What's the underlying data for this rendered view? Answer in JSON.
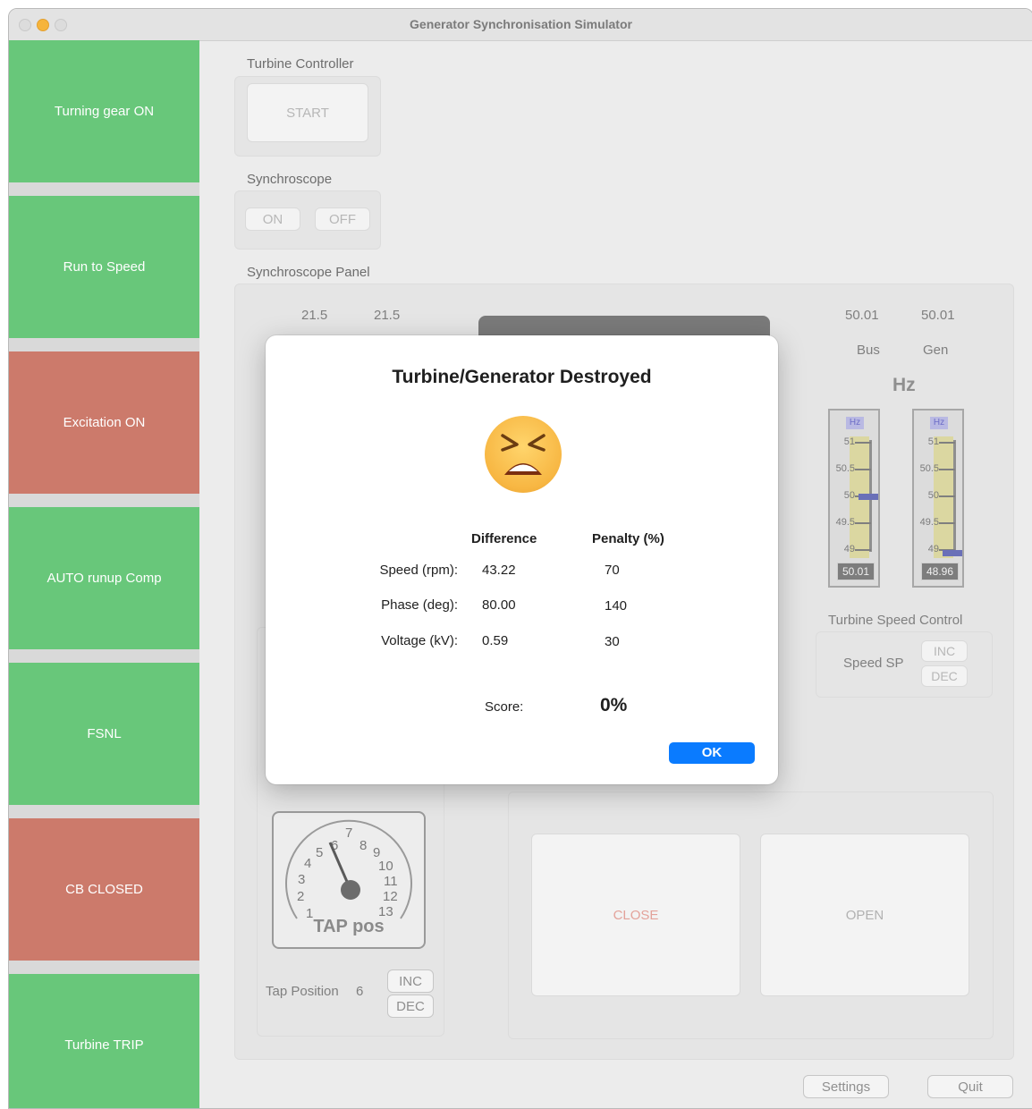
{
  "window": {
    "title": "Generator Synchronisation Simulator"
  },
  "sidebar": {
    "items": [
      {
        "label": "Turning gear ON",
        "status": "green"
      },
      {
        "label": "Run to Speed",
        "status": "green"
      },
      {
        "label": "Excitation ON",
        "status": "red"
      },
      {
        "label": "AUTO runup Comp",
        "status": "green"
      },
      {
        "label": "FSNL",
        "status": "green"
      },
      {
        "label": "CB CLOSED",
        "status": "red"
      },
      {
        "label": "Turbine TRIP",
        "status": "green"
      }
    ]
  },
  "turbine_controller": {
    "label": "Turbine Controller",
    "start": "START"
  },
  "synchroscope": {
    "label": "Synchroscope",
    "on": "ON",
    "off": "OFF"
  },
  "panel": {
    "label": "Synchroscope Panel",
    "volt_bus": "21.5",
    "volt_gen": "21.5",
    "freq_bus": "50.01",
    "freq_gen": "50.01",
    "bus": "Bus",
    "gen": "Gen",
    "hz": "Hz",
    "meters": [
      {
        "unit": "Hz",
        "ticks": [
          "51",
          "50.5",
          "50",
          "49.5",
          "49"
        ],
        "display": "50.01",
        "value": 50.01
      },
      {
        "unit": "Hz",
        "ticks": [
          "51",
          "50.5",
          "50",
          "49.5",
          "49"
        ],
        "display": "48.96",
        "value": 48.96
      }
    ],
    "turbine_speed_control": "Turbine Speed Control",
    "speed_sp": "Speed SP",
    "inc": "INC",
    "dec": "DEC"
  },
  "tap": {
    "gauge_label": "TAP pos",
    "ticks": [
      "1",
      "2",
      "3",
      "4",
      "5",
      "6",
      "7",
      "8",
      "9",
      "10",
      "11",
      "12",
      "13"
    ],
    "position_label": "Tap Position",
    "position_value": "6",
    "inc": "INC",
    "dec": "DEC"
  },
  "breaker": {
    "close": "CLOSE",
    "open": "OPEN"
  },
  "footer": {
    "settings": "Settings",
    "quit": "Quit"
  },
  "dialog": {
    "title": "Turbine/Generator Destroyed",
    "emoji": "tired-face-icon",
    "headers": {
      "difference": "Difference",
      "penalty": "Penalty (%)"
    },
    "rows": [
      {
        "label": "Speed (rpm):",
        "difference": "43.22",
        "penalty": "70"
      },
      {
        "label": "Phase (deg):",
        "difference": "80.00",
        "penalty": "140"
      },
      {
        "label": "Voltage (kV):",
        "difference": "0.59",
        "penalty": "30"
      }
    ],
    "score_label": "Score:",
    "score_value": "0%",
    "ok": "OK"
  },
  "colors": {
    "green": "#68c77a",
    "red": "#cc7a6b",
    "accent": "#0a7bff"
  }
}
